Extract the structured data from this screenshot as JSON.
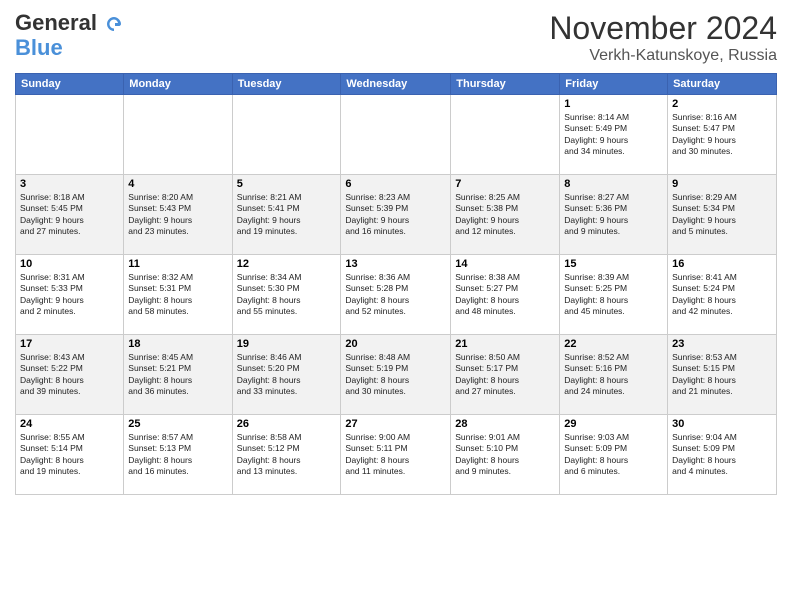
{
  "header": {
    "logo_line1": "General",
    "logo_line2": "Blue",
    "month_title": "November 2024",
    "location": "Verkh-Katunskoye, Russia"
  },
  "days_of_week": [
    "Sunday",
    "Monday",
    "Tuesday",
    "Wednesday",
    "Thursday",
    "Friday",
    "Saturday"
  ],
  "weeks": [
    [
      {
        "day": "",
        "info": ""
      },
      {
        "day": "",
        "info": ""
      },
      {
        "day": "",
        "info": ""
      },
      {
        "day": "",
        "info": ""
      },
      {
        "day": "",
        "info": ""
      },
      {
        "day": "1",
        "info": "Sunrise: 8:14 AM\nSunset: 5:49 PM\nDaylight: 9 hours\nand 34 minutes."
      },
      {
        "day": "2",
        "info": "Sunrise: 8:16 AM\nSunset: 5:47 PM\nDaylight: 9 hours\nand 30 minutes."
      }
    ],
    [
      {
        "day": "3",
        "info": "Sunrise: 8:18 AM\nSunset: 5:45 PM\nDaylight: 9 hours\nand 27 minutes."
      },
      {
        "day": "4",
        "info": "Sunrise: 8:20 AM\nSunset: 5:43 PM\nDaylight: 9 hours\nand 23 minutes."
      },
      {
        "day": "5",
        "info": "Sunrise: 8:21 AM\nSunset: 5:41 PM\nDaylight: 9 hours\nand 19 minutes."
      },
      {
        "day": "6",
        "info": "Sunrise: 8:23 AM\nSunset: 5:39 PM\nDaylight: 9 hours\nand 16 minutes."
      },
      {
        "day": "7",
        "info": "Sunrise: 8:25 AM\nSunset: 5:38 PM\nDaylight: 9 hours\nand 12 minutes."
      },
      {
        "day": "8",
        "info": "Sunrise: 8:27 AM\nSunset: 5:36 PM\nDaylight: 9 hours\nand 9 minutes."
      },
      {
        "day": "9",
        "info": "Sunrise: 8:29 AM\nSunset: 5:34 PM\nDaylight: 9 hours\nand 5 minutes."
      }
    ],
    [
      {
        "day": "10",
        "info": "Sunrise: 8:31 AM\nSunset: 5:33 PM\nDaylight: 9 hours\nand 2 minutes."
      },
      {
        "day": "11",
        "info": "Sunrise: 8:32 AM\nSunset: 5:31 PM\nDaylight: 8 hours\nand 58 minutes."
      },
      {
        "day": "12",
        "info": "Sunrise: 8:34 AM\nSunset: 5:30 PM\nDaylight: 8 hours\nand 55 minutes."
      },
      {
        "day": "13",
        "info": "Sunrise: 8:36 AM\nSunset: 5:28 PM\nDaylight: 8 hours\nand 52 minutes."
      },
      {
        "day": "14",
        "info": "Sunrise: 8:38 AM\nSunset: 5:27 PM\nDaylight: 8 hours\nand 48 minutes."
      },
      {
        "day": "15",
        "info": "Sunrise: 8:39 AM\nSunset: 5:25 PM\nDaylight: 8 hours\nand 45 minutes."
      },
      {
        "day": "16",
        "info": "Sunrise: 8:41 AM\nSunset: 5:24 PM\nDaylight: 8 hours\nand 42 minutes."
      }
    ],
    [
      {
        "day": "17",
        "info": "Sunrise: 8:43 AM\nSunset: 5:22 PM\nDaylight: 8 hours\nand 39 minutes."
      },
      {
        "day": "18",
        "info": "Sunrise: 8:45 AM\nSunset: 5:21 PM\nDaylight: 8 hours\nand 36 minutes."
      },
      {
        "day": "19",
        "info": "Sunrise: 8:46 AM\nSunset: 5:20 PM\nDaylight: 8 hours\nand 33 minutes."
      },
      {
        "day": "20",
        "info": "Sunrise: 8:48 AM\nSunset: 5:19 PM\nDaylight: 8 hours\nand 30 minutes."
      },
      {
        "day": "21",
        "info": "Sunrise: 8:50 AM\nSunset: 5:17 PM\nDaylight: 8 hours\nand 27 minutes."
      },
      {
        "day": "22",
        "info": "Sunrise: 8:52 AM\nSunset: 5:16 PM\nDaylight: 8 hours\nand 24 minutes."
      },
      {
        "day": "23",
        "info": "Sunrise: 8:53 AM\nSunset: 5:15 PM\nDaylight: 8 hours\nand 21 minutes."
      }
    ],
    [
      {
        "day": "24",
        "info": "Sunrise: 8:55 AM\nSunset: 5:14 PM\nDaylight: 8 hours\nand 19 minutes."
      },
      {
        "day": "25",
        "info": "Sunrise: 8:57 AM\nSunset: 5:13 PM\nDaylight: 8 hours\nand 16 minutes."
      },
      {
        "day": "26",
        "info": "Sunrise: 8:58 AM\nSunset: 5:12 PM\nDaylight: 8 hours\nand 13 minutes."
      },
      {
        "day": "27",
        "info": "Sunrise: 9:00 AM\nSunset: 5:11 PM\nDaylight: 8 hours\nand 11 minutes."
      },
      {
        "day": "28",
        "info": "Sunrise: 9:01 AM\nSunset: 5:10 PM\nDaylight: 8 hours\nand 9 minutes."
      },
      {
        "day": "29",
        "info": "Sunrise: 9:03 AM\nSunset: 5:09 PM\nDaylight: 8 hours\nand 6 minutes."
      },
      {
        "day": "30",
        "info": "Sunrise: 9:04 AM\nSunset: 5:09 PM\nDaylight: 8 hours\nand 4 minutes."
      }
    ]
  ]
}
